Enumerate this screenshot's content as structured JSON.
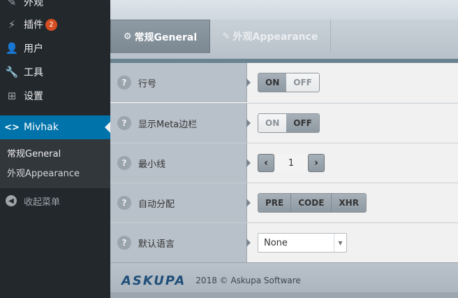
{
  "sidebar": {
    "items": [
      {
        "label": "外观",
        "icon": "brush-icon"
      },
      {
        "label": "插件",
        "icon": "plugin-icon",
        "badge": "2"
      },
      {
        "label": "用户",
        "icon": "user-icon"
      },
      {
        "label": "工具",
        "icon": "wrench-icon"
      },
      {
        "label": "设置",
        "icon": "settings-icon"
      }
    ],
    "active": {
      "label": "Mivhak",
      "icon": "code-icon"
    },
    "submenu": [
      "常规General",
      "外观Appearance"
    ],
    "collapse": "收起菜单"
  },
  "tabs": [
    {
      "label": "常规General",
      "icon": "gear-icon",
      "active": true
    },
    {
      "label": "外观Appearance",
      "icon": "brush-icon",
      "active": false
    }
  ],
  "settings": {
    "line_numbers": {
      "label": "行号",
      "on": "ON",
      "off": "OFF"
    },
    "meta_bar": {
      "label": "显示Meta边栏",
      "on": "ON",
      "off": "OFF"
    },
    "min_lines": {
      "label": "最小线",
      "value": "1"
    },
    "auto_assign": {
      "label": "自动分配",
      "options": [
        "PRE",
        "CODE",
        "XHR"
      ]
    },
    "default_lang": {
      "label": "默认语言",
      "value": "None"
    }
  },
  "footer": {
    "logo": "ASKUPA",
    "copyright": "2018 © Askupa Software"
  },
  "colors": {
    "sidebar_bg": "#23282d",
    "active_bg": "#0073aa",
    "badge": "#d54e21",
    "panel": "#b8c1c9"
  }
}
